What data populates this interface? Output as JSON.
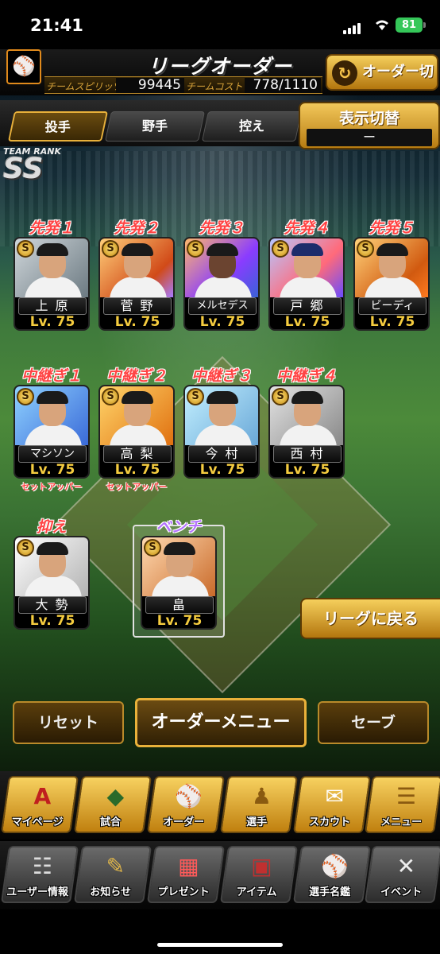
{
  "status_bar": {
    "time": "21:41",
    "battery": "81"
  },
  "header": {
    "title": "リーグオーダー",
    "team_logo": "giants-logo",
    "team_spirit_label": "チームスピリッツ",
    "team_spirit_value": "99445",
    "team_cost_label": "チームコスト",
    "team_cost_value": "778/1110",
    "order_switch_label": "オーダー切替"
  },
  "tabs": [
    {
      "label": "投手",
      "active": true
    },
    {
      "label": "野手",
      "active": false
    },
    {
      "label": "控え",
      "active": false
    }
  ],
  "display_switch": {
    "label": "表示切替",
    "value": "ー"
  },
  "team_rank": {
    "label": "TEAM RANK",
    "value": "SS"
  },
  "starters": [
    {
      "slot": "先発１",
      "name": "上 原",
      "level": "Lv. 75"
    },
    {
      "slot": "先発２",
      "name": "菅 野",
      "level": "Lv. 75"
    },
    {
      "slot": "先発３",
      "name": "メルセデス",
      "level": "Lv. 75"
    },
    {
      "slot": "先発４",
      "name": "戸 郷",
      "level": "Lv. 75"
    },
    {
      "slot": "先発５",
      "name": "ビーディ",
      "level": "Lv. 75"
    }
  ],
  "relievers": [
    {
      "slot": "中継ぎ１",
      "name": "マシソン",
      "level": "Lv. 75",
      "role": "セットアッパー"
    },
    {
      "slot": "中継ぎ２",
      "name": "高 梨",
      "level": "Lv. 75",
      "role": "セットアッパー"
    },
    {
      "slot": "中継ぎ３",
      "name": "今 村",
      "level": "Lv. 75",
      "role": ""
    },
    {
      "slot": "中継ぎ４",
      "name": "西 村",
      "level": "Lv. 75",
      "role": ""
    }
  ],
  "closer": {
    "slot": "抑え",
    "name": "大 勢",
    "level": "Lv. 75"
  },
  "bench": {
    "slot": "ベンチ",
    "name": "畠",
    "level": "Lv. 75"
  },
  "back_to_league": "リーグに戻る",
  "actions": {
    "reset": "リセット",
    "order_menu": "オーダーメニュー",
    "save": "セーブ"
  },
  "menu_top": [
    {
      "label": "マイページ",
      "icon": "mypage-icon",
      "glyph": "A"
    },
    {
      "label": "試合",
      "icon": "stadium-icon",
      "glyph": "◆"
    },
    {
      "label": "オーダー",
      "icon": "order-icon",
      "glyph": "⚾"
    },
    {
      "label": "選手",
      "icon": "player-icon",
      "glyph": "♟"
    },
    {
      "label": "スカウト",
      "icon": "scout-icon",
      "glyph": "✉"
    },
    {
      "label": "メニュー",
      "icon": "menu-icon",
      "glyph": "☰"
    }
  ],
  "menu_bottom": [
    {
      "label": "ユーザー情報",
      "icon": "user-info-icon",
      "glyph": "☷"
    },
    {
      "label": "お知らせ",
      "icon": "notice-icon",
      "glyph": "✎"
    },
    {
      "label": "プレゼント",
      "icon": "present-icon",
      "glyph": "🎁"
    },
    {
      "label": "アイテム",
      "icon": "item-icon",
      "glyph": "▣"
    },
    {
      "label": "選手名鑑",
      "icon": "player-book-icon",
      "glyph": "⚾"
    },
    {
      "label": "イベント",
      "icon": "event-icon",
      "glyph": "✕"
    }
  ],
  "colors": {
    "accent_gold": "#e8b03a",
    "slot_red": "#ff4343",
    "bench_purple": "#b473ff",
    "level_yellow": "#f5cc3f"
  }
}
